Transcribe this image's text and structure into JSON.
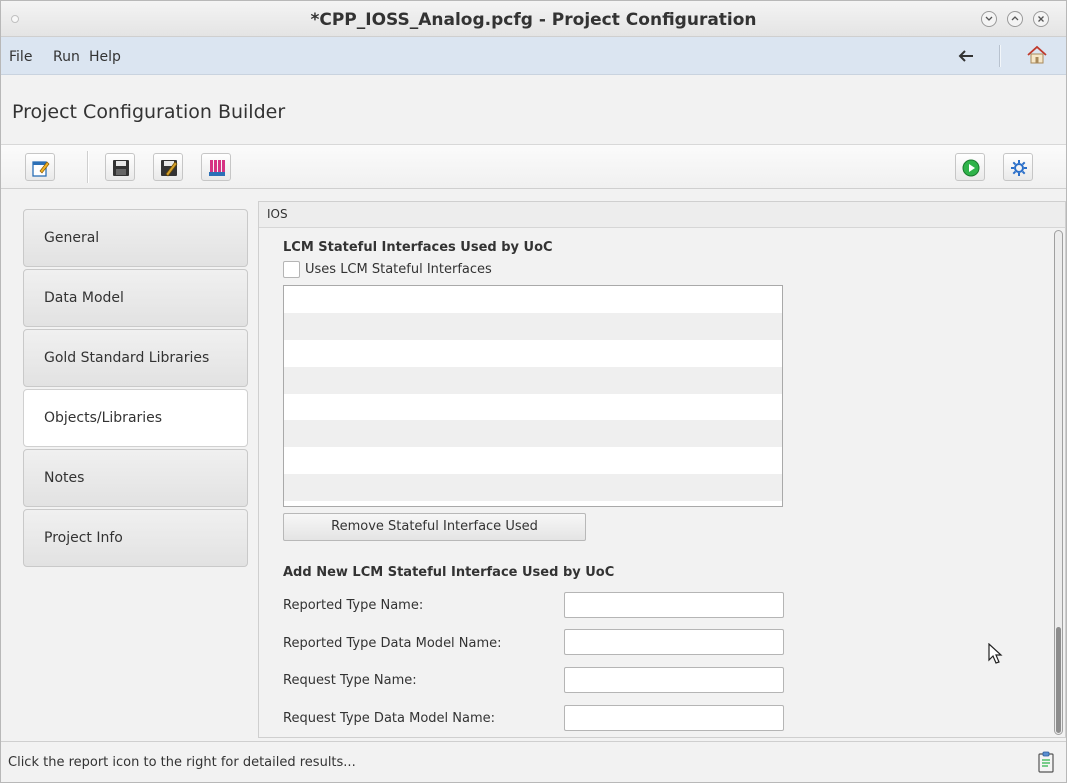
{
  "window": {
    "title": "*CPP_IOSS_Analog.pcfg - Project Configuration",
    "controls": [
      "minimize",
      "maximize",
      "close"
    ]
  },
  "menubar": {
    "items": [
      "File",
      "Run",
      "Help"
    ],
    "back_icon": "arrow-left-icon",
    "home_icon": "home-icon"
  },
  "header": {
    "title": "Project Configuration Builder"
  },
  "toolbar": {
    "buttons": [
      "edit-icon",
      "save-icon",
      "save-as-icon",
      "export-icon"
    ],
    "right_buttons": [
      "run-icon",
      "settings-icon"
    ]
  },
  "sidebar": {
    "items": [
      {
        "label": "General",
        "active": false
      },
      {
        "label": "Data Model",
        "active": false
      },
      {
        "label": "Gold Standard Libraries",
        "active": false
      },
      {
        "label": "Objects/Libraries",
        "active": true
      },
      {
        "label": "Notes",
        "active": false
      },
      {
        "label": "Project Info",
        "active": false
      }
    ]
  },
  "pane": {
    "title": "IOS",
    "stateful_section": {
      "heading": "LCM Stateful Interfaces Used by UoC",
      "checkbox_label": "Uses LCM Stateful Interfaces",
      "checkbox_checked": false,
      "list_rows": [],
      "remove_button": "Remove Stateful Interface Used"
    },
    "add_section": {
      "heading": "Add New LCM Stateful Interface Used by UoC",
      "fields": [
        {
          "label": "Reported Type Name:",
          "value": ""
        },
        {
          "label": "Reported Type Data Model Name:",
          "value": ""
        },
        {
          "label": "Request Type Name:",
          "value": ""
        },
        {
          "label": "Request Type Data Model Name:",
          "value": ""
        }
      ]
    }
  },
  "statusbar": {
    "message": "Click the report icon to the right for detailed results...",
    "report_icon": "clipboard-report-icon"
  },
  "colors": {
    "menubar_bg": "#dbe5f1",
    "run_green": "#2fb34a",
    "settings_blue": "#2a6fc9"
  }
}
